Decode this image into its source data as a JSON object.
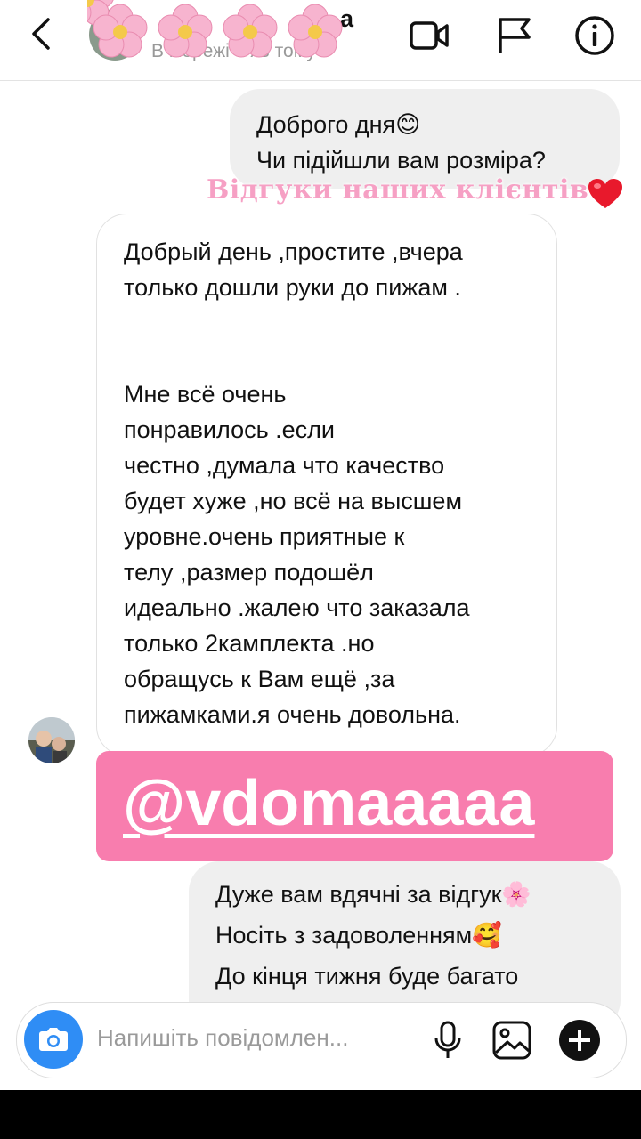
{
  "header": {
    "contact_name": "а",
    "status": "В мережі 8 хв тому",
    "icons": [
      "back-arrow-icon",
      "video-call-icon",
      "flag-icon",
      "info-icon"
    ]
  },
  "messages": [
    {
      "direction": "outgoing",
      "text": "Доброго дня😊\nЧи підійшли вам розміра?"
    },
    {
      "direction": "incoming",
      "text": "Добрый день ,простите ,вчера\nтолько дошли руки до пижам .\n\n\nМне всё очень\nпонравилось .если\nчестно ,думала что качество\nбудет хуже ,но всё на высшем\nуровне.очень приятные к\nтелу ,размер подошёл\nидеально .жалею что заказала\nтолько 2камплекта .но\nобращусь к Вам ещё ,за\nпижамками.я очень довольна."
    },
    {
      "direction": "outgoing",
      "text": "Дуже вам вдячні за відгук🌸\nНосіть з задоволенням🥰\nДо кінця тижня буде багато\nновинок)"
    }
  ],
  "overlay": {
    "caption": "Відгуки наших клієнтів",
    "tag": "@vdomaaaaa",
    "colors": {
      "tag_bg": "#f87dae",
      "caption": "#f6a0c4",
      "heart": "#e8192c"
    }
  },
  "composer": {
    "placeholder": "Напишіть повідомлен...",
    "icons": [
      "camera-icon",
      "microphone-icon",
      "gallery-icon",
      "plus-icon"
    ]
  }
}
